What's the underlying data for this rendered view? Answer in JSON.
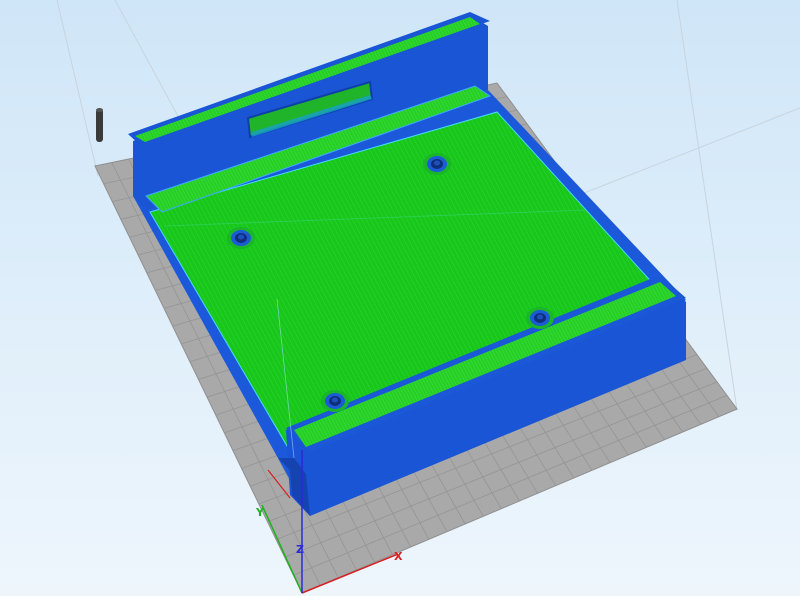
{
  "viewport": {
    "background_top": "#cfe6f8",
    "background_bottom": "#eef6fc",
    "bed_color": "#a9a9a9",
    "bed_grid_color": "#8f8f8f"
  },
  "model": {
    "wall_color": "#1a55d6",
    "wall_dark_color": "#1446b4",
    "top_face_color": "#22cc22",
    "top_face_edge_color": "#56e07a",
    "floor_color": "#17c41a",
    "screw_hole_count": 4
  },
  "axes": {
    "x_label": "X",
    "y_label": "Y",
    "z_label": "Z",
    "x_color": "#d62020",
    "y_color": "#1fb21f",
    "z_color": "#2a2ad6"
  },
  "extruder_marker": {
    "icon": "nozzle-marker-icon",
    "color": "#3a3a3a"
  }
}
